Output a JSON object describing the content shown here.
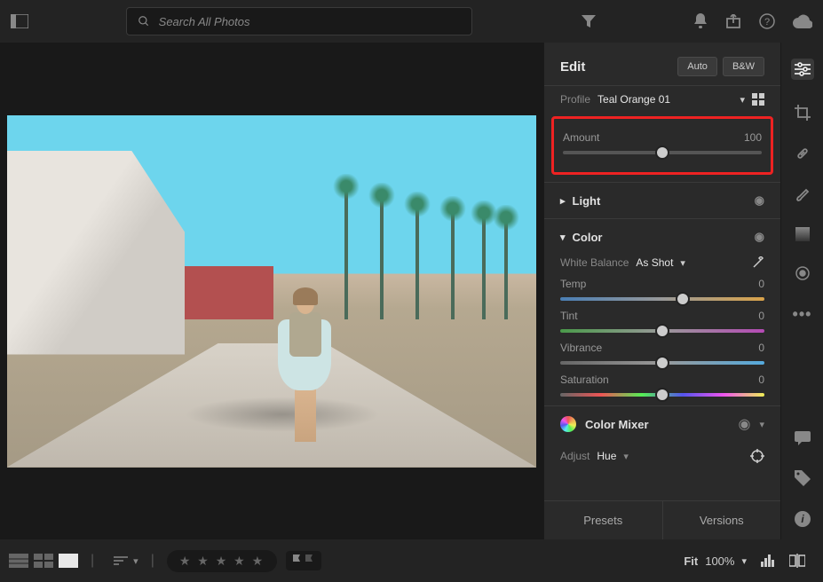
{
  "search": {
    "placeholder": "Search All Photos"
  },
  "edit": {
    "title": "Edit",
    "auto_label": "Auto",
    "bw_label": "B&W",
    "profile_label": "Profile",
    "profile_value": "Teal Orange 01",
    "amount": {
      "label": "Amount",
      "value": "100",
      "pos": 50
    },
    "sections": {
      "light": "Light",
      "color": "Color"
    },
    "white_balance": {
      "label": "White Balance",
      "value": "As Shot"
    },
    "sliders": {
      "temp": {
        "label": "Temp",
        "value": "0",
        "pos": 60
      },
      "tint": {
        "label": "Tint",
        "value": "0",
        "pos": 50
      },
      "vibrance": {
        "label": "Vibrance",
        "value": "0",
        "pos": 50
      },
      "saturation": {
        "label": "Saturation",
        "value": "0",
        "pos": 50
      }
    },
    "color_mixer": {
      "label": "Color Mixer",
      "adjust_label": "Adjust",
      "adjust_value": "Hue"
    }
  },
  "footer": {
    "fit_label": "Fit",
    "zoom_value": "100%",
    "presets_label": "Presets",
    "versions_label": "Versions"
  }
}
